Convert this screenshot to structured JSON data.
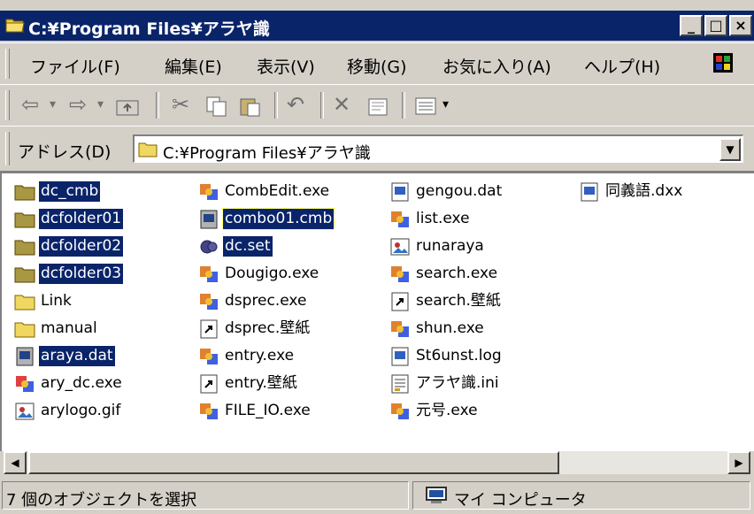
{
  "window": {
    "title": "C:¥Program Files¥アラヤ識",
    "minimize": "_",
    "maximize": "□",
    "close": "×"
  },
  "menu": [
    {
      "label": "ファイル(F)"
    },
    {
      "label": "編集(E)"
    },
    {
      "label": "表示(V)"
    },
    {
      "label": "移動(G)"
    },
    {
      "label": "お気に入り(A)"
    },
    {
      "label": "ヘルプ(H)"
    }
  ],
  "toolbar": {
    "back": "⇦",
    "forward": "⇨",
    "dropdown": "▾",
    "up_icon": "folder-up-icon",
    "cut": "✂",
    "copy_icon": "copy-icon",
    "paste_icon": "paste-icon",
    "undo": "↶",
    "delete": "✕",
    "properties_icon": "properties-icon",
    "views_icon": "views-icon"
  },
  "address": {
    "label": "アドレス(D)",
    "value": "C:¥Program Files¥アラヤ識",
    "dropdown": "▼"
  },
  "files": {
    "col1": [
      {
        "name": "dc_cmb",
        "icon": "folder-icon",
        "selected": true
      },
      {
        "name": "dcfolder01",
        "icon": "folder-icon",
        "selected": true
      },
      {
        "name": "dcfolder02",
        "icon": "folder-icon",
        "selected": true
      },
      {
        "name": "dcfolder03",
        "icon": "folder-icon",
        "selected": true
      },
      {
        "name": "Link",
        "icon": "folder-icon",
        "selected": false
      },
      {
        "name": "manual",
        "icon": "folder-icon",
        "selected": false
      },
      {
        "name": "araya.dat",
        "icon": "document-icon",
        "selected": true
      },
      {
        "name": "ary_dc.exe",
        "icon": "exe-icon",
        "selected": false
      },
      {
        "name": "arylogo.gif",
        "icon": "image-icon",
        "selected": false
      }
    ],
    "col2": [
      {
        "name": "CombEdit.exe",
        "icon": "exe-icon",
        "selected": false
      },
      {
        "name": "combo01.cmb",
        "icon": "document-icon",
        "selected": true
      },
      {
        "name": "dc.set",
        "icon": "settings-icon",
        "selected": true
      },
      {
        "name": "Dougigo.exe",
        "icon": "exe-icon",
        "selected": false
      },
      {
        "name": "dsprec.exe",
        "icon": "exe-icon",
        "selected": false
      },
      {
        "name": "dsprec.壁紙",
        "icon": "shortcut-icon",
        "selected": false
      },
      {
        "name": "entry.exe",
        "icon": "exe-icon",
        "selected": false
      },
      {
        "name": "entry.壁紙",
        "icon": "shortcut-icon",
        "selected": false
      },
      {
        "name": "FILE_IO.exe",
        "icon": "exe-icon",
        "selected": false
      }
    ],
    "col3": [
      {
        "name": "gengou.dat",
        "icon": "document-icon",
        "selected": false
      },
      {
        "name": "list.exe",
        "icon": "exe-icon",
        "selected": false
      },
      {
        "name": "runaraya",
        "icon": "image-icon",
        "selected": false
      },
      {
        "name": "search.exe",
        "icon": "exe-icon",
        "selected": false
      },
      {
        "name": "search.壁紙",
        "icon": "shortcut-icon",
        "selected": false
      },
      {
        "name": "shun.exe",
        "icon": "exe-icon",
        "selected": false
      },
      {
        "name": "St6unst.log",
        "icon": "document-icon",
        "selected": false
      },
      {
        "name": "アラヤ識.ini",
        "icon": "ini-icon",
        "selected": false
      },
      {
        "name": "元号.exe",
        "icon": "exe-icon",
        "selected": false
      }
    ],
    "col4": [
      {
        "name": "同義語.dxx",
        "icon": "document-icon",
        "selected": false
      }
    ]
  },
  "scrollbar": {
    "left": "◀",
    "right": "▶"
  },
  "status": {
    "selection": "7 個のオブジェクトを選択",
    "location": "マイ コンピュータ"
  },
  "colors": {
    "title_bar": "#0a246a",
    "selection": "#0a246a",
    "chrome": "#d4d0c8"
  }
}
